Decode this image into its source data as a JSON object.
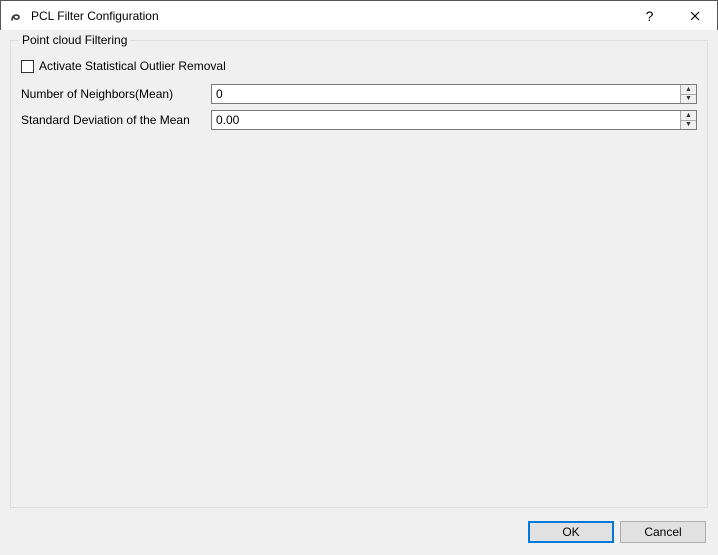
{
  "titlebar": {
    "title": "PCL Filter Configuration"
  },
  "groupbox": {
    "title": "Point cloud Filtering"
  },
  "checkbox": {
    "label": "Activate Statistical Outlier Removal",
    "checked": false
  },
  "fields": {
    "neighbors": {
      "label": "Number of Neighbors(Mean)",
      "value": "0"
    },
    "stddev": {
      "label": "Standard Deviation of the Mean",
      "value": "0.00"
    }
  },
  "buttons": {
    "ok": "OK",
    "cancel": "Cancel"
  }
}
